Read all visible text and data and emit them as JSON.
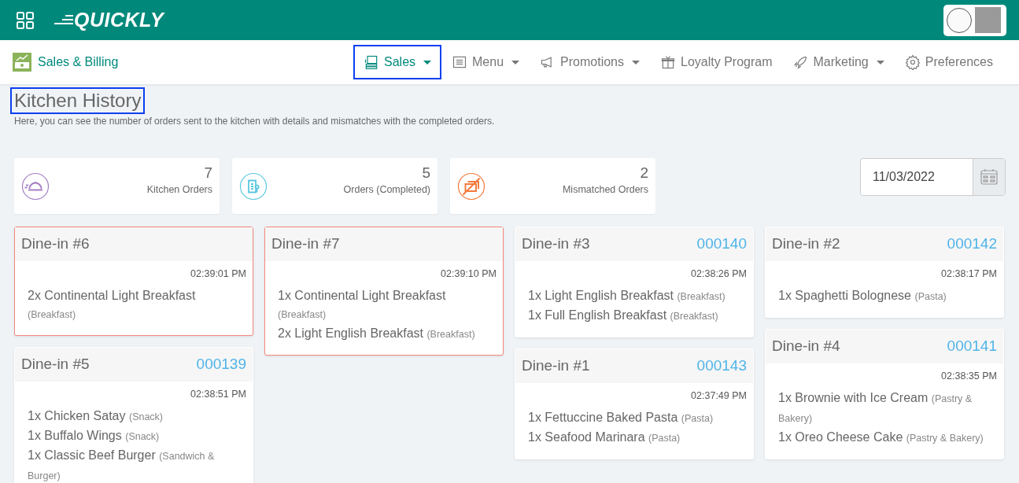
{
  "header": {
    "logo": "QUICKLY"
  },
  "subnav": {
    "brand": "Sales & Billing",
    "items": [
      {
        "label": "Sales",
        "dropdown": true,
        "selected": true
      },
      {
        "label": "Menu",
        "dropdown": true,
        "selected": false
      },
      {
        "label": "Promotions",
        "dropdown": true,
        "selected": false
      },
      {
        "label": "Loyalty Program",
        "dropdown": false,
        "selected": false
      },
      {
        "label": "Marketing",
        "dropdown": true,
        "selected": false
      },
      {
        "label": "Preferences",
        "dropdown": false,
        "selected": false
      }
    ]
  },
  "page": {
    "title": "Kitchen History",
    "highlighted": true,
    "subtitle": "Here, you can see the number of orders sent to the kitchen with details and mismatches with the completed orders."
  },
  "stats": [
    {
      "kind": "kitchen",
      "value": "7",
      "label": "Kitchen Orders",
      "color": "#a57fc4"
    },
    {
      "kind": "completed",
      "value": "5",
      "label": "Orders (Completed)",
      "color": "#5bc8e0"
    },
    {
      "kind": "mismatched",
      "value": "2",
      "label": "Mismatched Orders",
      "color": "#f47a3c"
    }
  ],
  "date_field": {
    "value": "11/03/2022"
  },
  "order_columns": [
    [
      {
        "title": "Dine-in #6",
        "mismatched": true,
        "time": "02:39:01 PM",
        "items": [
          {
            "name": "2x Continental Light Breakfast",
            "category": "(Breakfast)"
          }
        ]
      },
      {
        "title": "Dine-in #5",
        "number": "000139",
        "mismatched": false,
        "time": "02:38:51 PM",
        "items": [
          {
            "name": "1x Chicken Satay",
            "category": "(Snack)"
          },
          {
            "name": "1x Buffalo Wings",
            "category": "(Snack)"
          },
          {
            "name": "1x Classic Beef Burger",
            "category": "(Sandwich & Burger)"
          }
        ]
      }
    ],
    [
      {
        "title": "Dine-in #7",
        "mismatched": true,
        "time": "02:39:10 PM",
        "items": [
          {
            "name": "1x Continental Light Breakfast",
            "category": "(Breakfast)"
          },
          {
            "name": "2x Light English Breakfast",
            "category": "(Breakfast)"
          }
        ]
      }
    ],
    [
      {
        "title": "Dine-in #3",
        "number": "000140",
        "mismatched": false,
        "time": "02:38:26 PM",
        "items": [
          {
            "name": "1x Light English Breakfast",
            "category": "(Breakfast)"
          },
          {
            "name": "1x Full English Breakfast",
            "category": "(Breakfast)"
          }
        ]
      },
      {
        "title": "Dine-in #1",
        "number": "000143",
        "mismatched": false,
        "time": "02:37:49 PM",
        "items": [
          {
            "name": "1x Fettuccine Baked Pasta",
            "category": "(Pasta)"
          },
          {
            "name": "1x Seafood Marinara",
            "category": "(Pasta)"
          }
        ]
      }
    ],
    [
      {
        "title": "Dine-in #2",
        "number": "000142",
        "mismatched": false,
        "time": "02:38:17 PM",
        "items": [
          {
            "name": "1x Spaghetti Bolognese",
            "category": "(Pasta)"
          }
        ]
      },
      {
        "title": "Dine-in #4",
        "number": "000141",
        "mismatched": false,
        "time": "02:38:35 PM",
        "items": [
          {
            "name": "1x Brownie with Ice Cream",
            "category": "(Pastry & Bakery)"
          },
          {
            "name": "1x Oreo Cheese Cake",
            "category": "(Pastry & Bakery)"
          }
        ]
      }
    ]
  ]
}
